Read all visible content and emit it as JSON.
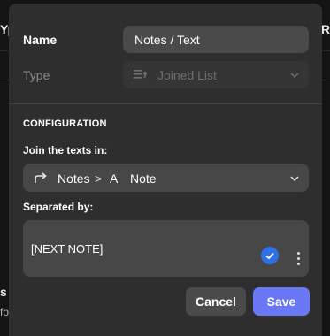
{
  "background": {
    "left_top_fragment": "Yp",
    "right_top_fragment": "RY",
    "left_fragment_s": "s",
    "left_fragment_fo": "fo"
  },
  "dialog": {
    "name_label": "Name",
    "name_value": "Notes / Text",
    "type_label": "Type",
    "type_value": "Joined List",
    "type_icon": "joined-list-icon",
    "section_title": "CONFIGURATION",
    "join_label": "Join the texts in:",
    "join_path": {
      "source": "Notes",
      "separator": ">",
      "field_icon": "A",
      "field": "Note"
    },
    "separator_label": "Separated by:",
    "separator_value": "[NEXT NOTE]",
    "cancel_label": "Cancel",
    "save_label": "Save"
  },
  "colors": {
    "accent_save": "#6a78f5",
    "check_blue": "#2f6fe8",
    "dialog_bg": "#2e2e2e"
  }
}
